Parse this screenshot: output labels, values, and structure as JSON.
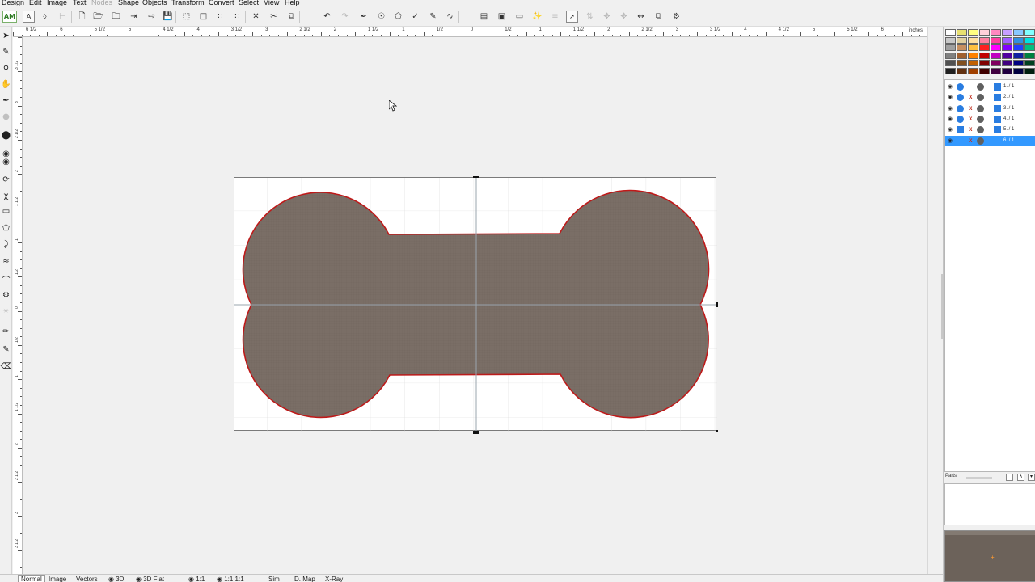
{
  "menu": [
    {
      "label": "Design"
    },
    {
      "label": "Edit"
    },
    {
      "label": "Image"
    },
    {
      "label": "Text"
    },
    {
      "label": "Nodes",
      "disabled": true
    },
    {
      "label": "Shape"
    },
    {
      "label": "Objects"
    },
    {
      "label": "Transform"
    },
    {
      "label": "Convert"
    },
    {
      "label": "Select"
    },
    {
      "label": "View"
    },
    {
      "label": "Help"
    }
  ],
  "toolbar": {
    "logo": "AM",
    "text_tool": "A"
  },
  "ruler": {
    "unit": "inches",
    "horizontal_labels": [
      "6 1/2",
      "6",
      "5 1/2",
      "5",
      "4 1/2",
      "4",
      "3 1/2",
      "3",
      "2 1/2",
      "2",
      "1 1/2",
      "1",
      "1/2",
      "0",
      "1/2",
      "1",
      "1 1/2",
      "2",
      "2 1/2",
      "3",
      "3 1/2",
      "4",
      "4 1/2",
      "5",
      "5 1/2",
      "6"
    ],
    "vertical_labels": [
      "3 1/2",
      "3",
      "2 1/2",
      "2",
      "1 1/2",
      "1",
      "1/2",
      "0",
      "1/2",
      "1",
      "1 1/2",
      "2",
      "2 1/2",
      "3",
      "3 1/2",
      "4"
    ]
  },
  "document": {
    "shape": "dog-bone",
    "fill_color": "#7a6e66",
    "outline_color": "#c01818",
    "grid_color": "#d8d8d8",
    "axis_color": "#9aa4ad"
  },
  "palette": {
    "colors": [
      "#ffffff",
      "#e8e070",
      "#ffff80",
      "#ffd0d8",
      "#ff88c0",
      "#c8a0ff",
      "#88c8ff",
      "#80ffff",
      "#c8c8c8",
      "#e0d0a0",
      "#ffe0a0",
      "#ff80a0",
      "#ff40a0",
      "#a060ff",
      "#3090e0",
      "#00e0e0",
      "#a0a0a0",
      "#c89060",
      "#ffc040",
      "#ff2020",
      "#ff00ff",
      "#8000ff",
      "#2040ff",
      "#00c080",
      "#808080",
      "#a06030",
      "#ff8000",
      "#c00000",
      "#c000c0",
      "#5000a0",
      "#1020a0",
      "#008040",
      "#505050",
      "#805020",
      "#c06000",
      "#800000",
      "#800060",
      "#400080",
      "#000080",
      "#004020",
      "#202020",
      "#603010",
      "#a04000",
      "#400000",
      "#400040",
      "#200040",
      "#000040",
      "#002010"
    ]
  },
  "layers": [
    {
      "label": "1. / 1",
      "selected": false,
      "marked": false,
      "square": false
    },
    {
      "label": "2. / 1",
      "selected": false,
      "marked": true,
      "square": false
    },
    {
      "label": "3. / 1",
      "selected": false,
      "marked": true,
      "square": false
    },
    {
      "label": "4. / 1",
      "selected": false,
      "marked": true,
      "square": false
    },
    {
      "label": "5. / 1",
      "selected": false,
      "marked": true,
      "square": true
    },
    {
      "label": "6. / 1",
      "selected": true,
      "marked": true,
      "square": false
    }
  ],
  "parts": {
    "label": "Parts"
  },
  "status_tabs": [
    {
      "label": "Normal",
      "active": true
    },
    {
      "label": "Image"
    },
    {
      "label": "Vectors"
    },
    {
      "label": "3D",
      "icon": true
    },
    {
      "label": "3D  Flat",
      "icon": true
    },
    {
      "label": "1:1",
      "icon": true
    },
    {
      "label": "1:1  1:1",
      "icon": true
    },
    {
      "label": "Sim"
    },
    {
      "label": "D. Map"
    },
    {
      "label": "X-Ray"
    }
  ]
}
